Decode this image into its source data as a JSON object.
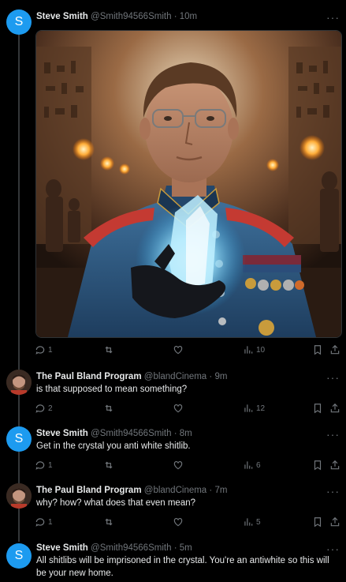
{
  "colors": {
    "accent": "#1d9bf0",
    "muted": "#71767b",
    "text": "#e7e9ea",
    "background": "#000000"
  },
  "tweets": [
    {
      "avatar_letter": "S",
      "name": "Steve Smith",
      "handle": "@Smith94566Smith",
      "dot": "·",
      "time": "10m",
      "text": "",
      "has_image": true,
      "replies": "1",
      "retweets": "",
      "likes": "",
      "views": "10"
    },
    {
      "avatar_letter": "",
      "name": "The Paul Bland Program",
      "handle": "@blandCinema",
      "dot": "·",
      "time": "9m",
      "text": "is that supposed to mean something?",
      "replies": "2",
      "retweets": "",
      "likes": "",
      "views": "12"
    },
    {
      "avatar_letter": "S",
      "name": "Steve Smith",
      "handle": "@Smith94566Smith",
      "dot": "·",
      "time": "8m",
      "text": "Get in the crystal you anti white shitlib.",
      "replies": "1",
      "retweets": "",
      "likes": "",
      "views": "6"
    },
    {
      "avatar_letter": "",
      "name": "The Paul Bland Program",
      "handle": "@blandCinema",
      "dot": "·",
      "time": "7m",
      "text": "why? how? what does that even mean?",
      "replies": "1",
      "retweets": "",
      "likes": "",
      "views": "5"
    },
    {
      "avatar_letter": "S",
      "name": "Steve Smith",
      "handle": "@Smith94566Smith",
      "dot": "·",
      "time": "5m",
      "text": "All shitlibs will be imprisoned in the crystal. You're an antiwhite so this will be your new home."
    }
  ],
  "more_label": "···"
}
